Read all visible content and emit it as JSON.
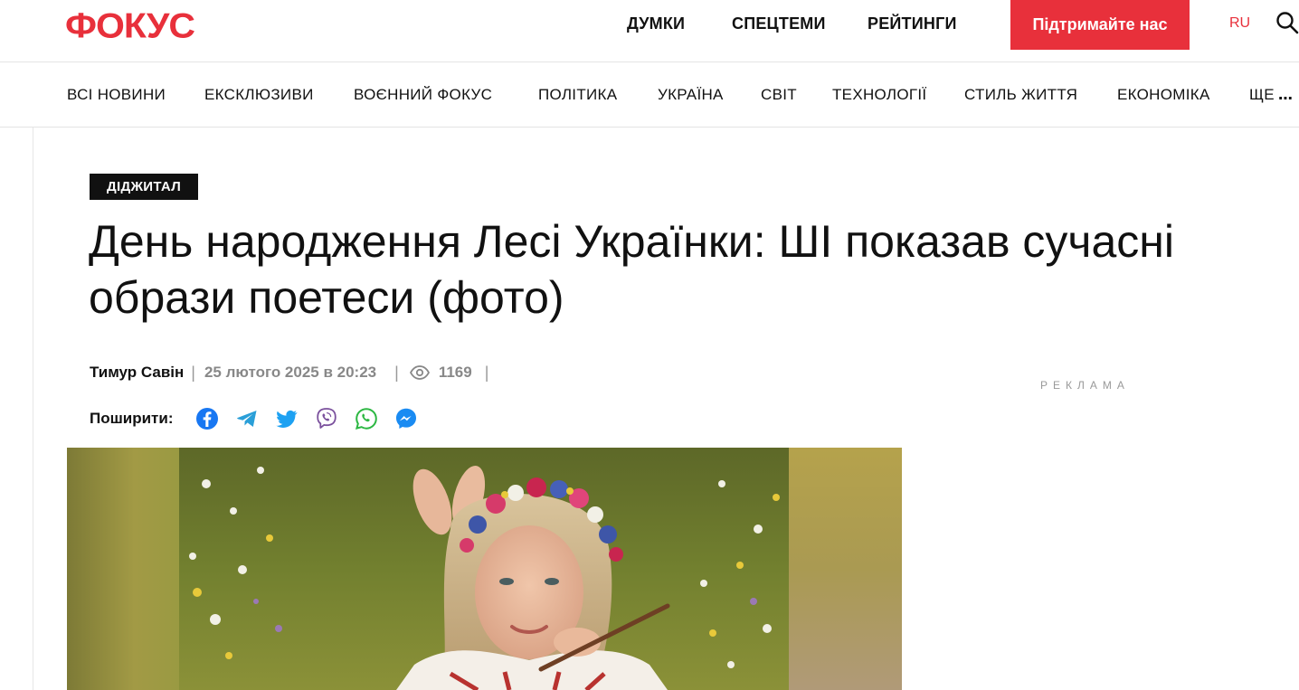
{
  "site": {
    "logo": "ФОКУС"
  },
  "top_nav": {
    "items": [
      {
        "label": "ДУМКИ"
      },
      {
        "label": "СПЕЦТЕМИ"
      },
      {
        "label": "РЕЙТИНГИ"
      }
    ],
    "support_label": "Підтримайте нас",
    "lang_label": "RU",
    "search_icon": "search-icon"
  },
  "categories": {
    "items": [
      {
        "label": "ВСІ НОВИНИ"
      },
      {
        "label": "ЕКСКЛЮЗИВИ"
      },
      {
        "label": "ВОЄННИЙ ФОКУС"
      },
      {
        "label": "ПОЛІТИКА"
      },
      {
        "label": "УКРАЇНА"
      },
      {
        "label": "СВІТ"
      },
      {
        "label": "ТЕХНОЛОГІЇ"
      },
      {
        "label": "СТИЛЬ ЖИТТЯ"
      },
      {
        "label": "ЕКОНОМІКА"
      },
      {
        "label": "ЩЕ"
      }
    ]
  },
  "article": {
    "tag": "ДІДЖИТАЛ",
    "headline": "День народження Лесі Українки: ШІ показав сучасні образи поетеси (фото)",
    "author": "Тимур Савін",
    "date": "25 лютого 2025 в 20:23",
    "views": "1169",
    "share_label": "Поширити:",
    "share_targets": [
      "facebook-icon",
      "telegram-icon",
      "twitter-icon",
      "viber-icon",
      "whatsapp-icon",
      "messenger-icon"
    ]
  },
  "ad": {
    "label": "РЕКЛАМА"
  },
  "colors": {
    "brand": "#e8303b",
    "tag_bg": "#111111"
  }
}
